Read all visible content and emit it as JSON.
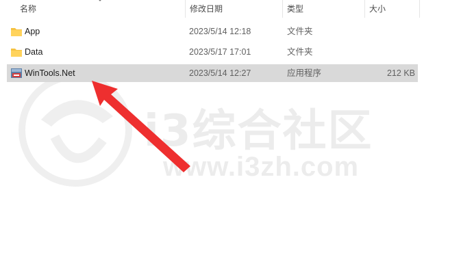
{
  "columns": {
    "name": "名称",
    "date": "修改日期",
    "type": "类型",
    "size": "大小"
  },
  "files": [
    {
      "name": "App",
      "date": "2023/5/14 12:18",
      "type": "文件夹",
      "size": "",
      "icon": "folder-icon",
      "selected": false
    },
    {
      "name": "Data",
      "date": "2023/5/17 17:01",
      "type": "文件夹",
      "size": "",
      "icon": "folder-icon",
      "selected": false
    },
    {
      "name": "WinTools.Net",
      "date": "2023/5/14 12:27",
      "type": "应用程序",
      "size": "212 KB",
      "icon": "app-icon",
      "selected": true
    }
  ],
  "watermark": {
    "site_name": "i3综合社区",
    "url": "www.i3zh.com"
  },
  "colors": {
    "selection": "#d9d9d9",
    "folder": "#f5c242",
    "arrow": "#ee2f2f"
  }
}
